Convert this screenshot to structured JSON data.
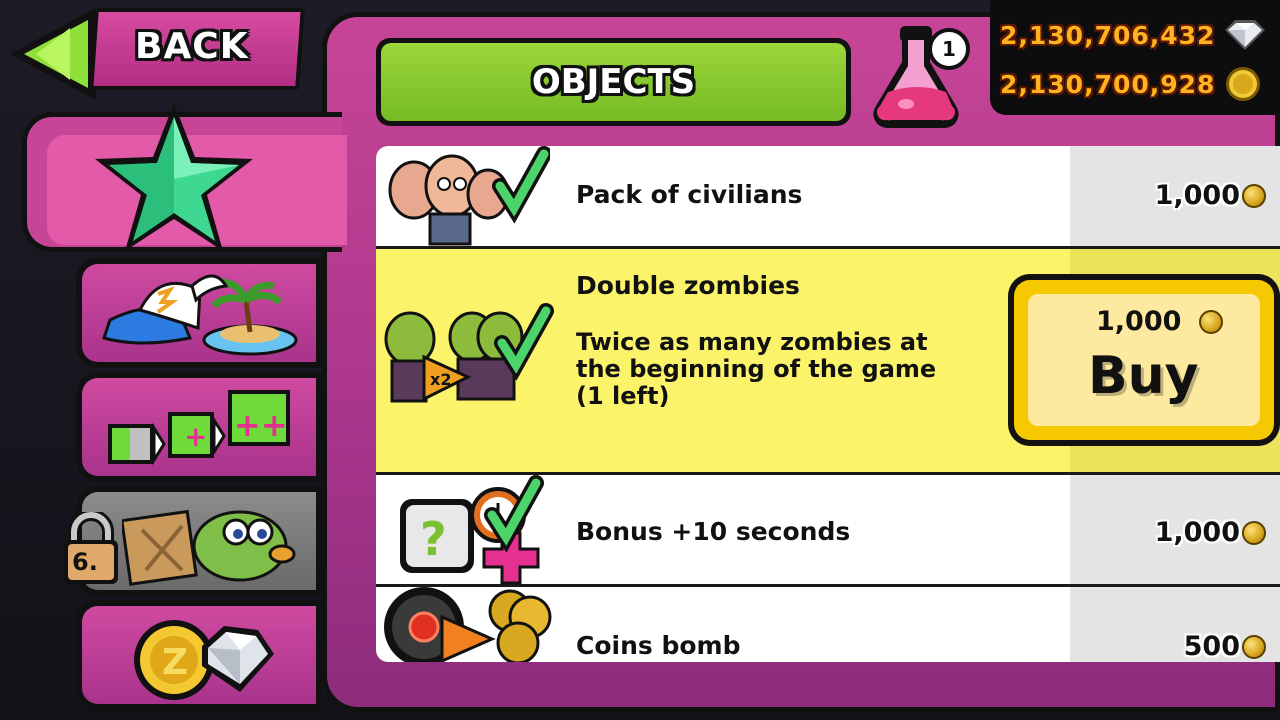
{
  "back": {
    "label": "BACK"
  },
  "header": {
    "title": "OBJECTS",
    "flask_count": "1"
  },
  "currency": {
    "gems": "2,130,706,432",
    "coins": "2,130,700,928"
  },
  "tabs": [
    {
      "name": "stars",
      "icon": "star-icon",
      "active": true
    },
    {
      "name": "boosters",
      "icon": "cap-island-icon"
    },
    {
      "name": "upgrades",
      "icon": "battery-plus-icon"
    },
    {
      "name": "locked",
      "icon": "crate-bird-icon",
      "lock_level": "6."
    },
    {
      "name": "currency",
      "icon": "coin-gem-icon"
    }
  ],
  "items": [
    {
      "name": "Pack of civilians",
      "price": "1,000"
    },
    {
      "name": "Double zombies",
      "description": "Twice as many zombies at the beginning of the game (1 left)",
      "price": "1,000"
    },
    {
      "name": "Bonus +10 seconds",
      "price": "1,000"
    },
    {
      "name": "Coins bomb",
      "price": "500"
    }
  ],
  "buy": {
    "price": "1,000",
    "label": "Buy"
  },
  "colors": {
    "frame": "#c74597",
    "title_green": "#8cc832",
    "selected_row": "#fbf36a",
    "buy_yellow": "#f5c800",
    "currency_text": "#ffb320"
  }
}
